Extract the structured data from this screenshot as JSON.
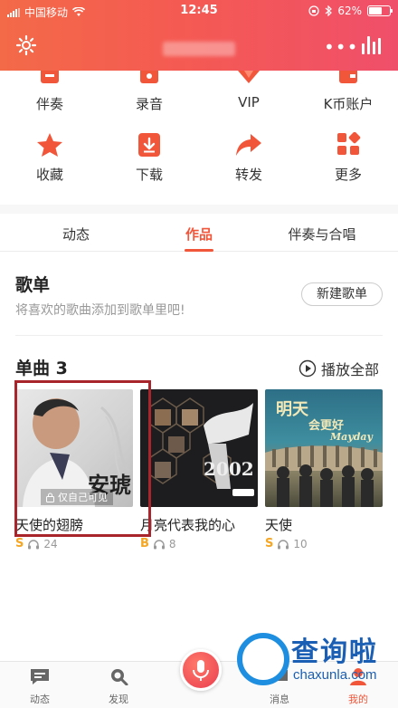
{
  "status_bar": {
    "carrier": "中国移动",
    "time": "12:45",
    "battery": "62%"
  },
  "header": {
    "more_icon": "ellipsis-icon",
    "stats_icon": "bars-icon",
    "settings_icon": "gear-icon"
  },
  "grid": [
    {
      "label": "伴奏",
      "icon": "accompaniment-icon"
    },
    {
      "label": "录音",
      "icon": "microphone-icon"
    },
    {
      "label": "VIP",
      "icon": "diamond-icon"
    },
    {
      "label": "K币账户",
      "icon": "wallet-icon"
    },
    {
      "label": "收藏",
      "icon": "star-icon"
    },
    {
      "label": "下载",
      "icon": "download-icon"
    },
    {
      "label": "转发",
      "icon": "share-arrow-icon"
    },
    {
      "label": "更多",
      "icon": "more-grid-icon"
    }
  ],
  "tabs": [
    {
      "label": "动态",
      "active": false
    },
    {
      "label": "作品",
      "active": true
    },
    {
      "label": "伴奏与合唱",
      "active": false
    }
  ],
  "playlist": {
    "title": "歌单",
    "subtitle": "将喜欢的歌曲添加到歌单里吧!",
    "new_button": "新建歌单"
  },
  "singles": {
    "title": "单曲 3",
    "play_all": "播放全部",
    "songs": [
      {
        "name": "天使的翅膀",
        "badge": "S",
        "plays": "24",
        "private_label": "仅自己可见",
        "cover_text": "安琥"
      },
      {
        "name": "月亮代表我的心",
        "badge": "B",
        "plays": "8",
        "cover_text": "2002"
      },
      {
        "name": "天使",
        "badge": "S",
        "plays": "10",
        "cover_text": "Mayday"
      }
    ]
  },
  "bottom_nav": [
    {
      "label": "动态",
      "icon": "feed-icon"
    },
    {
      "label": "发现",
      "icon": "discover-search-icon"
    },
    {
      "label": "",
      "icon": "sing-center-icon"
    },
    {
      "label": "消息",
      "icon": "message-icon"
    },
    {
      "label": "我的",
      "icon": "profile-icon"
    }
  ],
  "watermark": {
    "title": "查询啦",
    "url": "chaxunla.com"
  },
  "colors": {
    "accent": "#f2563a",
    "header_start": "#f36a48",
    "header_end": "#f04f6a",
    "badge": "#f5a623",
    "highlight": "#a8262b"
  }
}
